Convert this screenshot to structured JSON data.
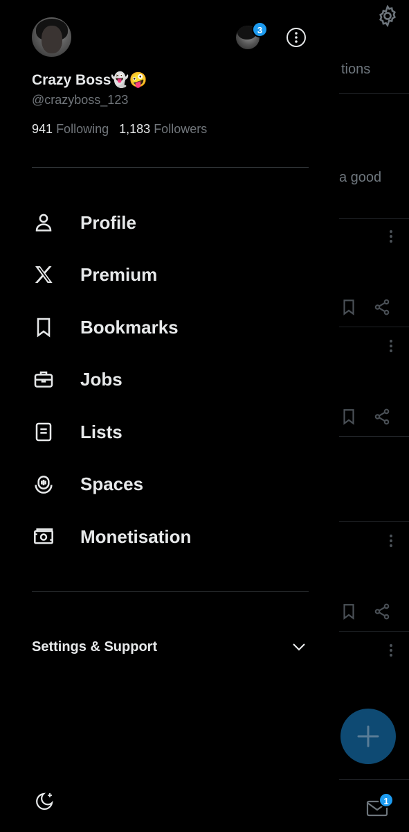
{
  "profile": {
    "display_name": "Crazy Boss👻🤪",
    "handle": "@crazyboss_123",
    "following_count": "941",
    "following_label": "Following",
    "followers_count": "1,183",
    "followers_label": "Followers"
  },
  "account_switcher": {
    "badge_count": "3"
  },
  "menu": {
    "items": [
      {
        "label": "Profile",
        "icon": "person-icon"
      },
      {
        "label": "Premium",
        "icon": "x-logo-icon"
      },
      {
        "label": "Bookmarks",
        "icon": "bookmark-icon"
      },
      {
        "label": "Jobs",
        "icon": "briefcase-icon"
      },
      {
        "label": "Lists",
        "icon": "list-icon"
      },
      {
        "label": "Spaces",
        "icon": "spaces-icon"
      },
      {
        "label": "Monetisation",
        "icon": "money-icon"
      }
    ]
  },
  "settings_support": {
    "label": "Settings & Support"
  },
  "background": {
    "tab_fragment": "tions",
    "post_fragment": "a good",
    "mail_badge": "1"
  },
  "colors": {
    "background": "#000000",
    "text_primary": "#e7e9ea",
    "text_secondary": "#71767b",
    "accent": "#1d9bf0",
    "fab_dimmed": "#0e4a73"
  }
}
